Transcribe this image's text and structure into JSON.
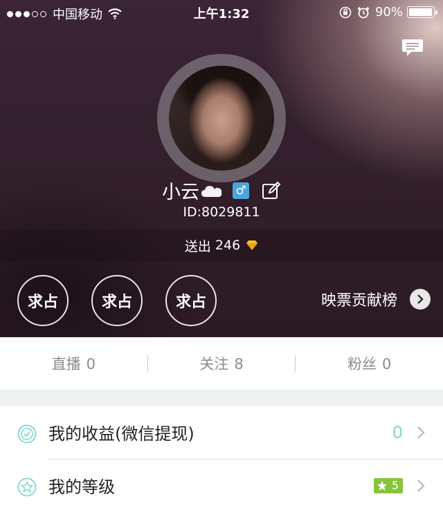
{
  "status_bar": {
    "carrier": "中国移动",
    "time": "上午1:32",
    "battery": "90%"
  },
  "profile": {
    "username": "小云",
    "gender_symbol": "♂",
    "user_id": "ID:8029811",
    "sent_label": "送出",
    "sent_count": "246",
    "badges": [
      "求占",
      "求占",
      "求占"
    ],
    "ranking_label": "映票贡献榜"
  },
  "stats": [
    {
      "label": "直播",
      "value": "0"
    },
    {
      "label": "关注",
      "value": "8"
    },
    {
      "label": "粉丝",
      "value": "0"
    }
  ],
  "menu": [
    {
      "label": "我的收益(微信提现)",
      "value": "0"
    },
    {
      "label": "我的等级",
      "level": "5"
    }
  ],
  "colors": {
    "accent_teal": "#7fd6cf",
    "level_green": "#86c43b",
    "gender_blue": "#4aa6e0"
  }
}
